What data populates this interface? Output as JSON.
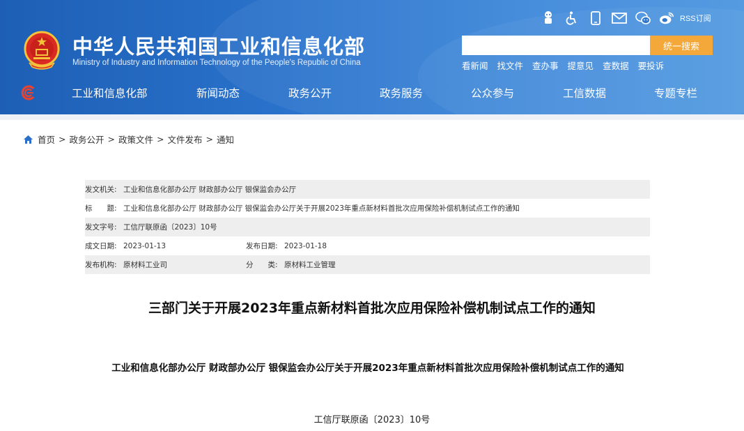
{
  "header": {
    "title_cn": "中华人民共和国工业和信息化部",
    "title_en": "Ministry of Industry and Information Technology of the People's Republic of China",
    "top_icons": [
      "robot-icon",
      "accessibility-icon",
      "mobile-icon",
      "mail-icon",
      "wechat-icon",
      "weibo-icon"
    ],
    "rss_label": "RSS订阅",
    "search": {
      "placeholder": "",
      "button_label": "统一搜索"
    },
    "quick_links": [
      "看新闻",
      "找文件",
      "查办事",
      "提意见",
      "查数据",
      "要投诉"
    ],
    "colors": {
      "header_blue": "#2a73cc",
      "search_button": "#f4a83a"
    }
  },
  "nav": {
    "items": [
      "工业和信息化部",
      "新闻动态",
      "政务公开",
      "政务服务",
      "公众参与",
      "工信数据",
      "专题专栏"
    ]
  },
  "breadcrumb": {
    "items": [
      "首页",
      "政务公开",
      "政策文件",
      "文件发布",
      "通知"
    ],
    "separator": ">"
  },
  "meta": {
    "issuer_label": "发文机关:",
    "issuer": "工业和信息化部办公厅 财政部办公厅 银保监会办公厅",
    "subject_label": "标　　题:",
    "subject": "工业和信息化部办公厅 财政部办公厅 银保监会办公厅关于开展2023年重点新材料首批次应用保险补偿机制试点工作的通知",
    "docno_label": "发文字号:",
    "docno": "工信厅联原函〔2023〕10号",
    "date_label": "成文日期:",
    "date": "2023-01-13",
    "pubdate_label": "发布日期:",
    "pubdate": "2023-01-18",
    "org_label": "发布机构:",
    "org": "原材料工业司",
    "category_label": "分　　类:",
    "category": "原材料工业管理"
  },
  "document": {
    "title": "三部门关于开展2023年重点新材料首批次应用保险补偿机制试点工作的通知",
    "heading": "工业和信息化部办公厅  财政部办公厅  银保监会办公厅关于开展2023年重点新材料首批次应用保险补偿机制试点工作的通知",
    "number": "工信厅联原函〔2023〕10号"
  }
}
